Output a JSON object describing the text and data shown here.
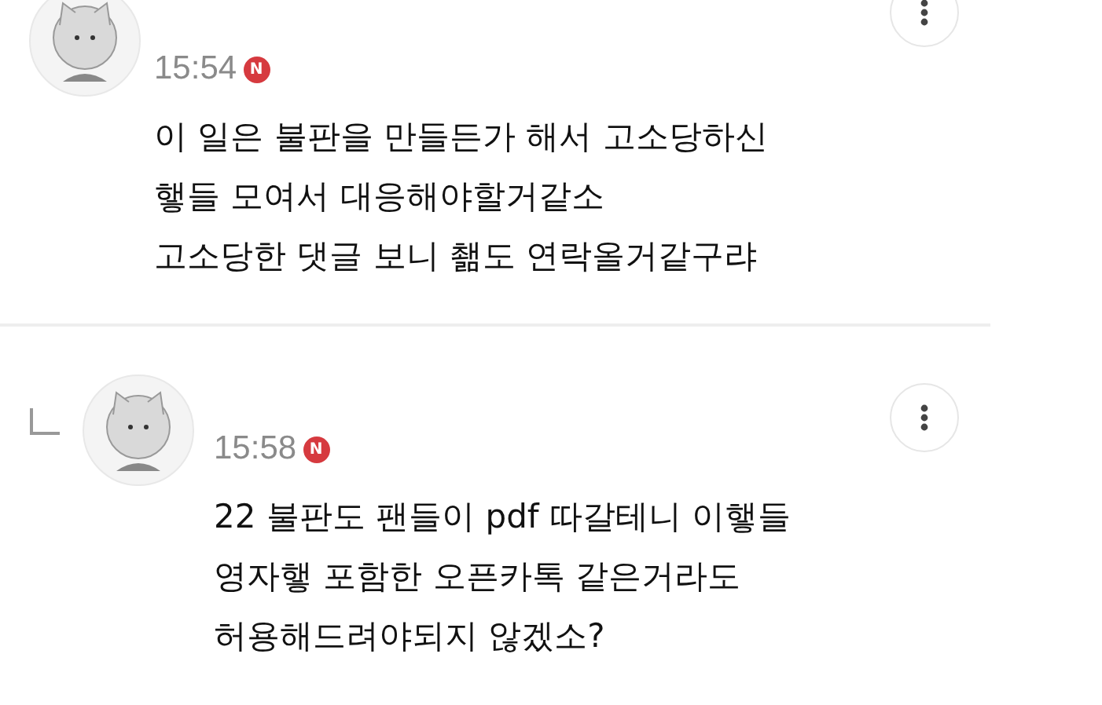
{
  "comments": [
    {
      "is_reply": false,
      "time": "15:54",
      "badge": "N",
      "lines": [
        "이 일은 불판을 만들든가 해서 고소당하신",
        "햏들 모여서 대응해야할거같소",
        "고소당한 댓글 보니 쵊도 연락올거같구랴"
      ]
    },
    {
      "is_reply": true,
      "time": "15:58",
      "badge": "N",
      "lines": [
        "22 불판도 팬들이 pdf 따갈테니 이햏들",
        "영자햏 포함한 오픈카톡 같은거라도",
        "허용해드려야되지 않겠소?"
      ]
    }
  ]
}
